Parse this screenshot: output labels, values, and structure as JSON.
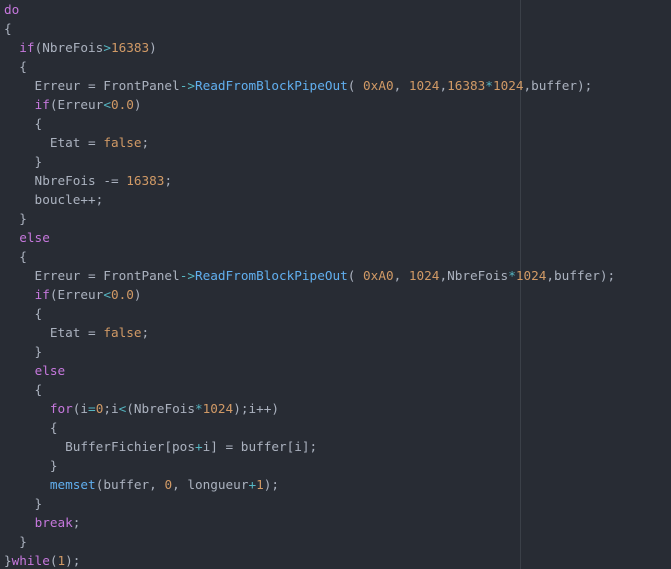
{
  "theme": {
    "background": "#282c34",
    "text": "#abb2bf",
    "keyword": "#c678dd",
    "number": "#d19a66",
    "function": "#61afef",
    "operator": "#56b6c2"
  },
  "code_lines": [
    [
      {
        "t": "do",
        "c": "kw"
      }
    ],
    [
      {
        "t": "{",
        "c": "p"
      }
    ],
    [
      {
        "t": "  ",
        "c": "p"
      },
      {
        "t": "if",
        "c": "kw"
      },
      {
        "t": "(NbreFois",
        "c": "p"
      },
      {
        "t": ">",
        "c": "op"
      },
      {
        "t": "16383",
        "c": "num"
      },
      {
        "t": ")",
        "c": "p"
      }
    ],
    [
      {
        "t": "  {",
        "c": "p"
      }
    ],
    [
      {
        "t": "    Erreur ",
        "c": "p"
      },
      {
        "t": "=",
        "c": "p"
      },
      {
        "t": " FrontPanel",
        "c": "p"
      },
      {
        "t": "->",
        "c": "op"
      },
      {
        "t": "ReadFromBlockPipeOut",
        "c": "fn"
      },
      {
        "t": "( ",
        "c": "p"
      },
      {
        "t": "0xA0",
        "c": "num"
      },
      {
        "t": ", ",
        "c": "p"
      },
      {
        "t": "1024",
        "c": "num"
      },
      {
        "t": ",",
        "c": "p"
      },
      {
        "t": "16383",
        "c": "num"
      },
      {
        "t": "*",
        "c": "op"
      },
      {
        "t": "1024",
        "c": "num"
      },
      {
        "t": ",buffer);",
        "c": "p"
      }
    ],
    [
      {
        "t": "    ",
        "c": "p"
      },
      {
        "t": "if",
        "c": "kw"
      },
      {
        "t": "(Erreur",
        "c": "p"
      },
      {
        "t": "<",
        "c": "op"
      },
      {
        "t": "0.0",
        "c": "num"
      },
      {
        "t": ")",
        "c": "p"
      }
    ],
    [
      {
        "t": "    {",
        "c": "p"
      }
    ],
    [
      {
        "t": "      Etat ",
        "c": "p"
      },
      {
        "t": "=",
        "c": "p"
      },
      {
        "t": " ",
        "c": "p"
      },
      {
        "t": "false",
        "c": "num"
      },
      {
        "t": ";",
        "c": "p"
      }
    ],
    [
      {
        "t": "    }",
        "c": "p"
      }
    ],
    [
      {
        "t": "    NbreFois ",
        "c": "p"
      },
      {
        "t": "-=",
        "c": "p"
      },
      {
        "t": " ",
        "c": "p"
      },
      {
        "t": "16383",
        "c": "num"
      },
      {
        "t": ";",
        "c": "p"
      }
    ],
    [
      {
        "t": "    boucle++;",
        "c": "p"
      }
    ],
    [
      {
        "t": "  }",
        "c": "p"
      }
    ],
    [
      {
        "t": "  ",
        "c": "p"
      },
      {
        "t": "else",
        "c": "kw"
      }
    ],
    [
      {
        "t": "  {",
        "c": "p"
      }
    ],
    [
      {
        "t": "    Erreur ",
        "c": "p"
      },
      {
        "t": "=",
        "c": "p"
      },
      {
        "t": " FrontPanel",
        "c": "p"
      },
      {
        "t": "->",
        "c": "op"
      },
      {
        "t": "ReadFromBlockPipeOut",
        "c": "fn"
      },
      {
        "t": "( ",
        "c": "p"
      },
      {
        "t": "0xA0",
        "c": "num"
      },
      {
        "t": ", ",
        "c": "p"
      },
      {
        "t": "1024",
        "c": "num"
      },
      {
        "t": ",NbreFois",
        "c": "p"
      },
      {
        "t": "*",
        "c": "op"
      },
      {
        "t": "1024",
        "c": "num"
      },
      {
        "t": ",buffer);",
        "c": "p"
      }
    ],
    [
      {
        "t": "    ",
        "c": "p"
      },
      {
        "t": "if",
        "c": "kw"
      },
      {
        "t": "(Erreur",
        "c": "p"
      },
      {
        "t": "<",
        "c": "op"
      },
      {
        "t": "0.0",
        "c": "num"
      },
      {
        "t": ")",
        "c": "p"
      }
    ],
    [
      {
        "t": "    {",
        "c": "p"
      }
    ],
    [
      {
        "t": "      Etat ",
        "c": "p"
      },
      {
        "t": "=",
        "c": "p"
      },
      {
        "t": " ",
        "c": "p"
      },
      {
        "t": "false",
        "c": "num"
      },
      {
        "t": ";",
        "c": "p"
      }
    ],
    [
      {
        "t": "    }",
        "c": "p"
      }
    ],
    [
      {
        "t": "    ",
        "c": "p"
      },
      {
        "t": "else",
        "c": "kw"
      }
    ],
    [
      {
        "t": "    {",
        "c": "p"
      }
    ],
    [
      {
        "t": "      ",
        "c": "p"
      },
      {
        "t": "for",
        "c": "kw"
      },
      {
        "t": "(i",
        "c": "p"
      },
      {
        "t": "=",
        "c": "op"
      },
      {
        "t": "0",
        "c": "num"
      },
      {
        "t": ";i",
        "c": "p"
      },
      {
        "t": "<",
        "c": "op"
      },
      {
        "t": "(NbreFois",
        "c": "p"
      },
      {
        "t": "*",
        "c": "op"
      },
      {
        "t": "1024",
        "c": "num"
      },
      {
        "t": ");i++)",
        "c": "p"
      }
    ],
    [
      {
        "t": "      {",
        "c": "p"
      }
    ],
    [
      {
        "t": "        BufferFichier[pos",
        "c": "p"
      },
      {
        "t": "+",
        "c": "op"
      },
      {
        "t": "i] ",
        "c": "p"
      },
      {
        "t": "=",
        "c": "p"
      },
      {
        "t": " buffer[i];",
        "c": "p"
      }
    ],
    [
      {
        "t": "      }",
        "c": "p"
      }
    ],
    [
      {
        "t": "      ",
        "c": "p"
      },
      {
        "t": "memset",
        "c": "fn"
      },
      {
        "t": "(buffer, ",
        "c": "p"
      },
      {
        "t": "0",
        "c": "num"
      },
      {
        "t": ", longueur",
        "c": "p"
      },
      {
        "t": "+",
        "c": "op"
      },
      {
        "t": "1",
        "c": "num"
      },
      {
        "t": ");",
        "c": "p"
      }
    ],
    [
      {
        "t": "    }",
        "c": "p"
      }
    ],
    [
      {
        "t": "    ",
        "c": "p"
      },
      {
        "t": "break",
        "c": "kw"
      },
      {
        "t": ";",
        "c": "p"
      }
    ],
    [
      {
        "t": "  }",
        "c": "p"
      }
    ],
    [
      {
        "t": "}",
        "c": "p"
      },
      {
        "t": "while",
        "c": "kw"
      },
      {
        "t": "(",
        "c": "p"
      },
      {
        "t": "1",
        "c": "num"
      },
      {
        "t": ");",
        "c": "p"
      }
    ]
  ]
}
